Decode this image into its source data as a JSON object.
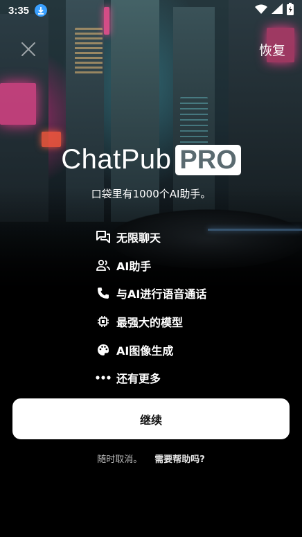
{
  "status_bar": {
    "time": "3:35",
    "icons": [
      "download-icon",
      "wifi-icon",
      "signal-icon",
      "battery-icon"
    ]
  },
  "header": {
    "close_icon": "close-icon",
    "restore_label": "恢复"
  },
  "brand": {
    "name": "ChatPub",
    "badge": "PRO",
    "tagline": "口袋里有1000个AI助手。"
  },
  "features": [
    {
      "icon": "chat-icon",
      "label": "无限聊天"
    },
    {
      "icon": "people-icon",
      "label": "AI助手"
    },
    {
      "icon": "phone-icon",
      "label": "与AI进行语音通话"
    },
    {
      "icon": "chip-icon",
      "label": "最强大的模型"
    },
    {
      "icon": "palette-icon",
      "label": "AI图像生成"
    },
    {
      "icon": "more-icon",
      "label": "还有更多"
    }
  ],
  "continue_button": {
    "label": "继续"
  },
  "footer": {
    "cancel_text": "随时取消。",
    "help_link": "需要帮助吗?"
  },
  "colors": {
    "background": "#000000",
    "button_bg": "#ffffff",
    "accent_download": "#3aa0ff",
    "pro_text": "#5a6a70"
  }
}
